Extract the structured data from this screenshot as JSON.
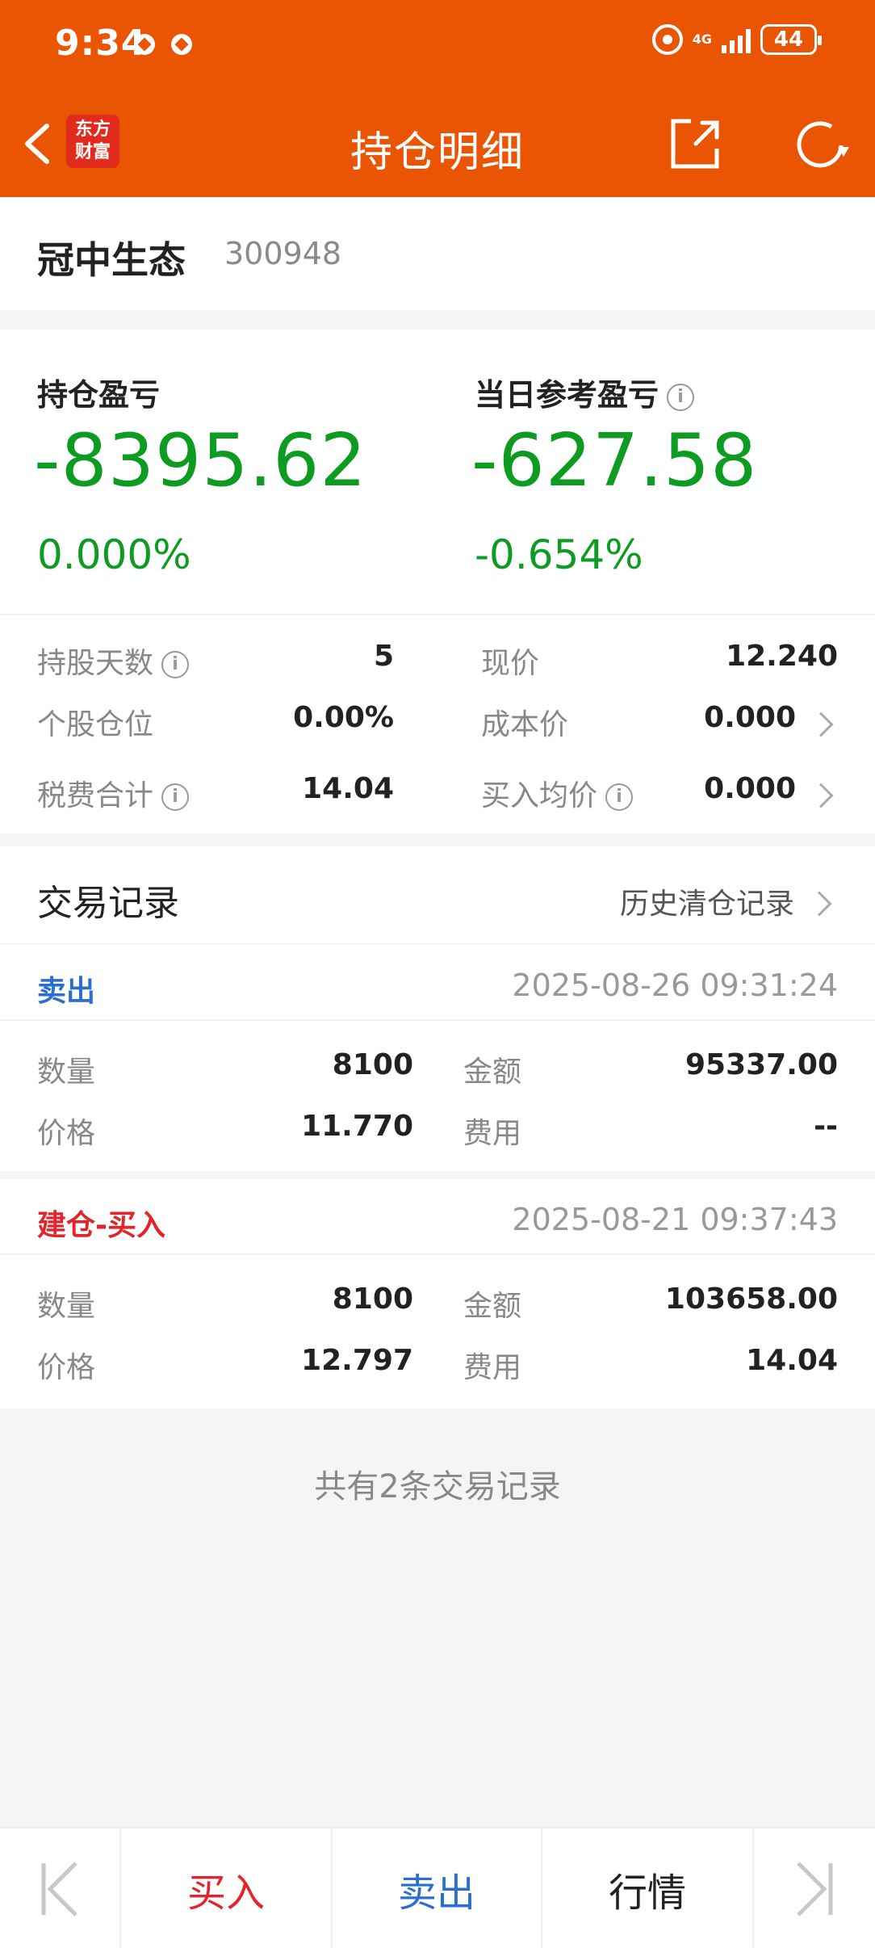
{
  "status_bar": {
    "time": "9:34",
    "network": "4G",
    "battery": "44"
  },
  "nav": {
    "title": "持仓明细",
    "logo_line1": "东方",
    "logo_line2": "财富"
  },
  "stock": {
    "name": "冠中生态",
    "code": "300948"
  },
  "summary": {
    "position_pl_label": "持仓盈亏",
    "position_pl_value": "-8395.62",
    "position_pl_pct": "0.000%",
    "daily_pl_label": "当日参考盈亏",
    "daily_pl_value": "-627.58",
    "daily_pl_pct": "-0.654%",
    "rows": [
      {
        "left_label": "持股天数",
        "left_value": "5",
        "right_label": "现价",
        "right_value": "12.240"
      },
      {
        "left_label": "个股仓位",
        "left_value": "0.00%",
        "right_label": "成本价",
        "right_value": "0.000"
      },
      {
        "left_label": "税费合计",
        "left_value": "14.04",
        "right_label": "买入均价",
        "right_value": "0.000"
      }
    ]
  },
  "trades": {
    "title": "交易记录",
    "history_link": "历史清仓记录",
    "records": [
      {
        "type": "卖出",
        "type_color": "#2a6fd0",
        "time": "2025-08-26 09:31:24",
        "qty_label": "数量",
        "qty": "8100",
        "amount_label": "金额",
        "amount": "95337.00",
        "price_label": "价格",
        "price": "11.770",
        "fee_label": "费用",
        "fee": "--"
      },
      {
        "type": "建仓-买入",
        "type_color": "#e0262b",
        "time": "2025-08-21 09:37:43",
        "qty_label": "数量",
        "qty": "8100",
        "amount_label": "金额",
        "amount": "103658.00",
        "price_label": "价格",
        "price": "12.797",
        "fee_label": "费用",
        "fee": "14.04"
      }
    ],
    "total_text": "共有2条交易记录"
  },
  "bottom_bar": {
    "buy": "买入",
    "sell": "卖出",
    "quote": "行情",
    "buy_color": "#e0262b",
    "sell_color": "#2a6fd0"
  }
}
